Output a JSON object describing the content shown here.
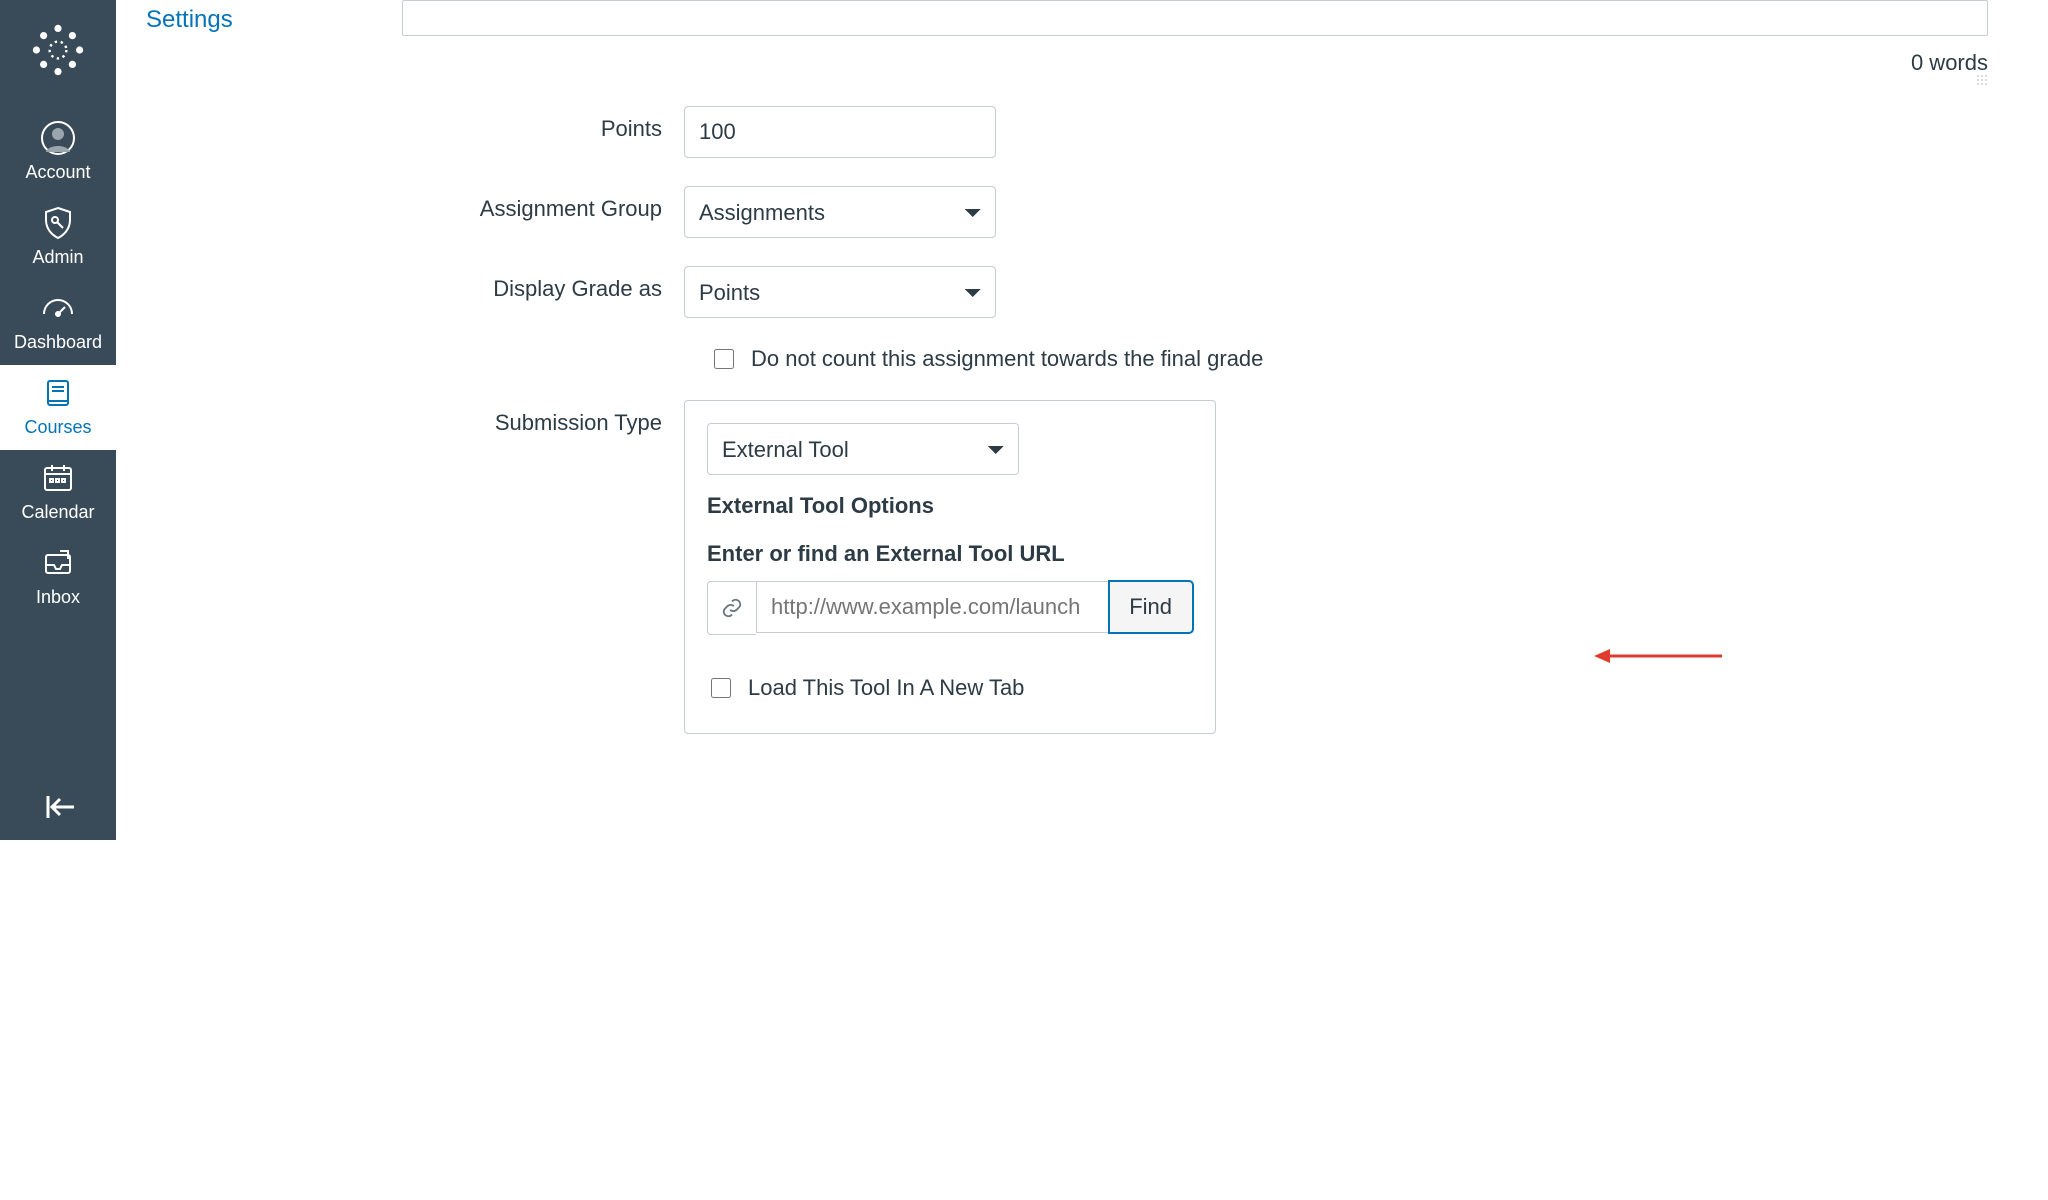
{
  "sidebar": {
    "items": [
      {
        "label": "Account"
      },
      {
        "label": "Admin"
      },
      {
        "label": "Dashboard"
      },
      {
        "label": "Courses"
      },
      {
        "label": "Calendar"
      },
      {
        "label": "Inbox"
      }
    ]
  },
  "secondary_nav": {
    "settings_label": "Settings"
  },
  "editor": {
    "word_count": "0 words"
  },
  "form": {
    "points": {
      "label": "Points",
      "value": "100"
    },
    "assignment_group": {
      "label": "Assignment Group",
      "value": "Assignments"
    },
    "display_grade": {
      "label": "Display Grade as",
      "value": "Points"
    },
    "exclude_final": {
      "label": "Do not count this assignment towards the final grade"
    },
    "submission": {
      "label": "Submission Type",
      "type_value": "External Tool",
      "options_heading": "External Tool Options",
      "url_heading": "Enter or find an External Tool URL",
      "url_placeholder": "http://www.example.com/launch",
      "find_label": "Find",
      "load_new_tab_label": "Load This Tool In A New Tab"
    }
  }
}
